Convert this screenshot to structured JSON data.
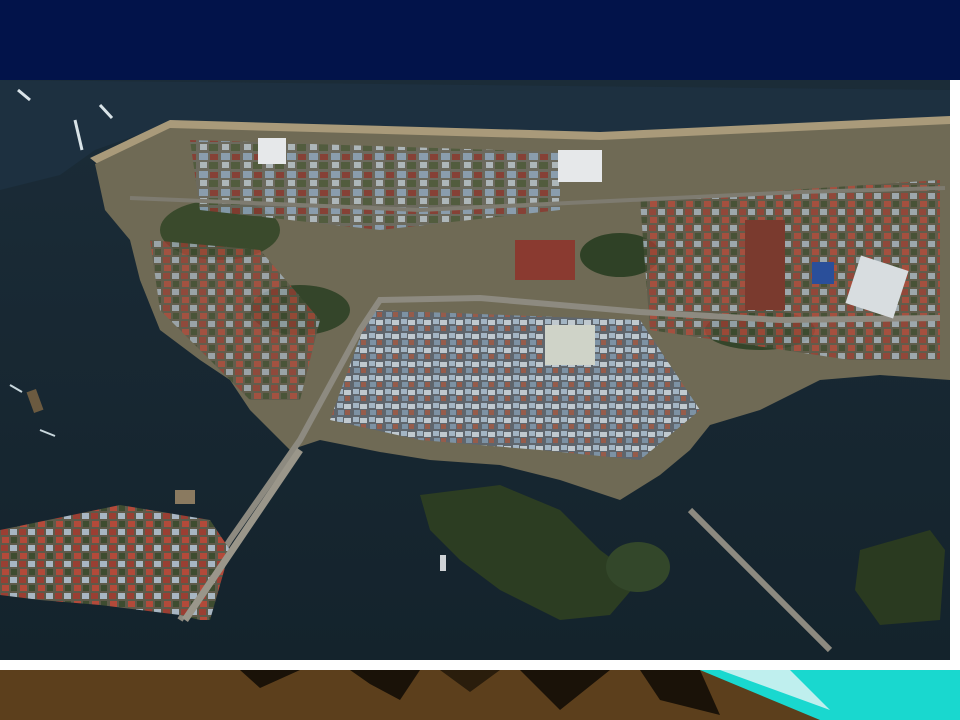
{
  "slide": {
    "header_band_color": "#02134a",
    "background_color": "#ffffff"
  },
  "image": {
    "subject": "aerial-satellite-photo",
    "colors": {
      "sea": "#1e3140",
      "sea_dark": "#13232f",
      "bay": "#24353d",
      "land": "#6f6a55",
      "road": "#8d8a80",
      "vegetation": "#2c3d22",
      "roof_blue": "#8fa6bd",
      "roof_red": "#8a3a30",
      "roof_white": "#e6e8ea",
      "beach": "#a99a7a"
    }
  },
  "footer": {
    "band_colors": {
      "brown": "#5c3f1c",
      "dark": "#1a1208",
      "teal": "#19d8cf",
      "light": "#bfefee"
    }
  }
}
